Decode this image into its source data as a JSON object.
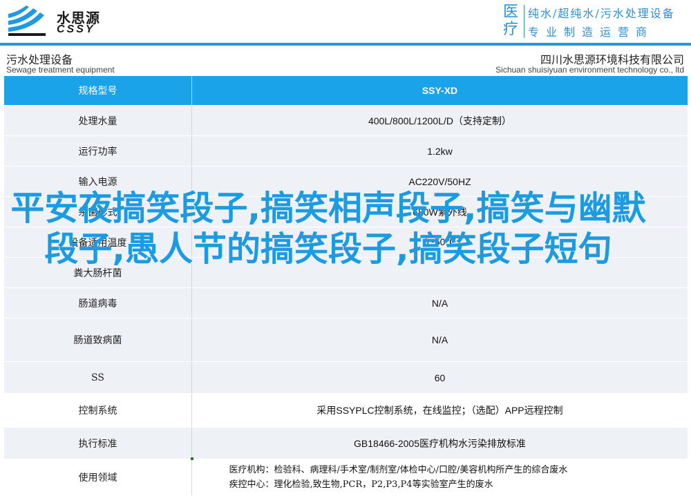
{
  "header": {
    "logo_cn": "水思源",
    "logo_en": "CSSY",
    "slogan_big": "医疗",
    "slogan_line1": "纯水/超纯水/污水处理设备",
    "slogan_line2": "专业制造运营商",
    "brand_color": "#1d9be0"
  },
  "titlebar": {
    "left_cn": "污水处理设备",
    "left_en": "Sewage treatment equipment",
    "right_cn": "四川水思源环境科技有限公司",
    "right_en": "Sichuan shuisiyuan environment technology co., ltd"
  },
  "table": {
    "header": {
      "label": "规格型号",
      "value": "SSY-XD"
    },
    "rows": [
      {
        "label": "处理水量",
        "value": "400L/800L/1200L/D（支持定制）"
      },
      {
        "label": "运行功率",
        "value": "1.2kw"
      },
      {
        "label": "输入电源",
        "value": "AC220V/50HZ"
      },
      {
        "label": "杀菌形式",
        "value": "680W紫外线"
      },
      {
        "label": "设备适用温度",
        "value": "0~50℃"
      },
      {
        "label": "粪大肠杆菌",
        "value": ""
      },
      {
        "label": "肠道病毒",
        "value": "N/A"
      },
      {
        "label": "肠道致病菌",
        "value": "N/A"
      },
      {
        "label": "SS",
        "value": "60"
      },
      {
        "label": "控制系统",
        "value": "采用SSYPLC控制系统，在线监控；（选配）APP远程控制"
      },
      {
        "label": "执行标准",
        "value": "GB18466-2005医疗机构水污染排放标准"
      },
      {
        "label": "使用领域",
        "value_lines": [
          "医疗机构：检验科、病理科/手术室/制剂室/体检中心/口腔/美容机构所产生的综合废水",
          "疾控中心：理化检验,致生物,PCR，P2,P3,P4等实验室产生的废水"
        ]
      }
    ]
  },
  "overlay_text": "平安夜搞笑段子,搞笑相声段子,搞笑与幽默段子,愚人节的搞笑段子,搞笑段子短句"
}
